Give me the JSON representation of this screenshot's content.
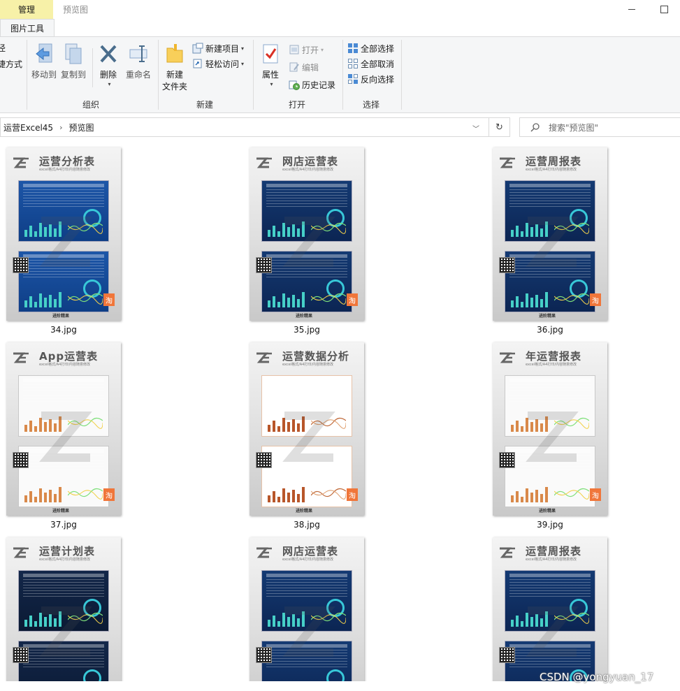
{
  "titlebar": {
    "context_tab": "管理",
    "context_sub": "图片工具",
    "window_title": "预览图"
  },
  "ribbon": {
    "clipped_left": [
      "径",
      "捷方式"
    ],
    "organize": {
      "label": "组织",
      "move_to": "移动到",
      "copy_to": "复制到",
      "delete": "删除",
      "rename": "重命名"
    },
    "new": {
      "label": "新建",
      "new_folder": "新建\n文件夹",
      "new_item": "新建项目",
      "easy_access": "轻松访问"
    },
    "open": {
      "label": "打开",
      "properties": "属性",
      "open": "打开",
      "edit": "编辑",
      "history": "历史记录"
    },
    "select": {
      "label": "选择",
      "select_all": "全部选择",
      "select_none": "全部取消",
      "invert": "反向选择"
    }
  },
  "address": {
    "crumbs": [
      "运营Excel45",
      "预览图"
    ],
    "search_placeholder": "搜索\"预览图\""
  },
  "files": [
    {
      "name": "34.jpg",
      "title": "运营分析表",
      "subtitle": "excel格式/A4打印/内容随意修改",
      "brand": "进阶精果"
    },
    {
      "name": "35.jpg",
      "title": "网店运营表",
      "subtitle": "excel格式/A4打印/内容随意修改",
      "brand": "进阶精果"
    },
    {
      "name": "36.jpg",
      "title": "运营周报表",
      "subtitle": "excel格式/A4打印/内容随意修改",
      "brand": "进阶精果"
    },
    {
      "name": "37.jpg",
      "title": "App运营表",
      "subtitle": "excel格式/A4打印/内容随意修改",
      "brand": "进阶精果"
    },
    {
      "name": "38.jpg",
      "title": "运营数据分析",
      "subtitle": "excel格式/A4打印/内容随意修改",
      "brand": "进阶精果"
    },
    {
      "name": "39.jpg",
      "title": "年运营报表",
      "subtitle": "excel格式/A4打印/内容随意修改",
      "brand": "进阶精果"
    },
    {
      "name": "",
      "title": "运营计划表",
      "subtitle": "excel格式/A4打印/内容随意修改",
      "brand": ""
    },
    {
      "name": "",
      "title": "网店运营表",
      "subtitle": "excel格式/A4打印/内容随意修改",
      "brand": ""
    },
    {
      "name": "",
      "title": "运营周报表",
      "subtitle": "excel格式/A4打印/内容随意修改",
      "brand": ""
    }
  ],
  "badge_char": "淘",
  "watermark": "CSDN @yongyuan_17",
  "colors": {
    "context_tab": "#f7f1a8",
    "ribbon_bg": "#f5f6f7",
    "accent_blue": "#1d56a8",
    "accent_orange": "#f0763a"
  }
}
